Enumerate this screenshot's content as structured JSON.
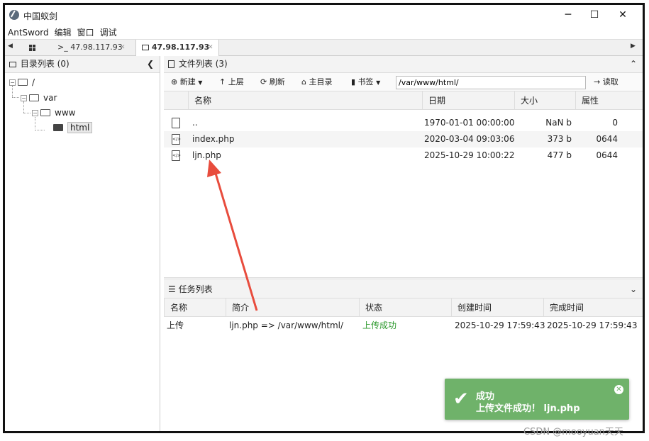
{
  "window": {
    "title": "中国蚁剑",
    "minimize": "─",
    "maximize": "☐",
    "close": "✕"
  },
  "menu": [
    "AntSword",
    "编辑",
    "窗口",
    "调试"
  ],
  "tabs": {
    "home_icon": "grid-icon",
    "tab1": {
      "prefix": ">_",
      "label": "47.98.117.93",
      "close": "✕"
    },
    "tab2": {
      "label": "47.98.117.93",
      "close": "✕"
    }
  },
  "left_panel": {
    "title": "目录列表 (0)",
    "tree": [
      {
        "label": "/",
        "level": 0
      },
      {
        "label": "var",
        "level": 1
      },
      {
        "label": "www",
        "level": 2
      },
      {
        "label": "html",
        "level": 3,
        "selected": true
      }
    ]
  },
  "file_panel": {
    "title": "文件列表 (3)",
    "toolbar": {
      "new": "新建",
      "up": "上层",
      "refresh": "刷新",
      "home": "主目录",
      "bookmark": "书签",
      "path": "/var/www/html/",
      "read": "读取"
    },
    "columns": [
      "名称",
      "日期",
      "大小",
      "属性"
    ],
    "rows": [
      {
        "name": "..",
        "date": "1970-01-01 00:00:00",
        "size": "NaN b",
        "attr": "0"
      },
      {
        "name": "index.php",
        "date": "2020-03-04 09:03:06",
        "size": "373 b",
        "attr": "0644"
      },
      {
        "name": "ljn.php",
        "date": "2025-10-29 10:00:22",
        "size": "477 b",
        "attr": "0644"
      }
    ]
  },
  "task_panel": {
    "title": "任务列表",
    "columns": [
      "名称",
      "简介",
      "状态",
      "创建时间",
      "完成时间"
    ],
    "rows": [
      {
        "name": "上传",
        "desc": "ljn.php => /var/www/html/",
        "status": "上传成功",
        "created": "2025-10-29 17:59:43",
        "finished": "2025-10-29 17:59:43"
      }
    ]
  },
  "toast": {
    "title": "成功",
    "message": "上传文件成功！ ljn.php",
    "color": "#6fb26a"
  },
  "watermark": "CSDN @mooyuan天天",
  "colors": {
    "success_text": "#2e9a2e",
    "annotation_arrow": "#e84c3d"
  }
}
